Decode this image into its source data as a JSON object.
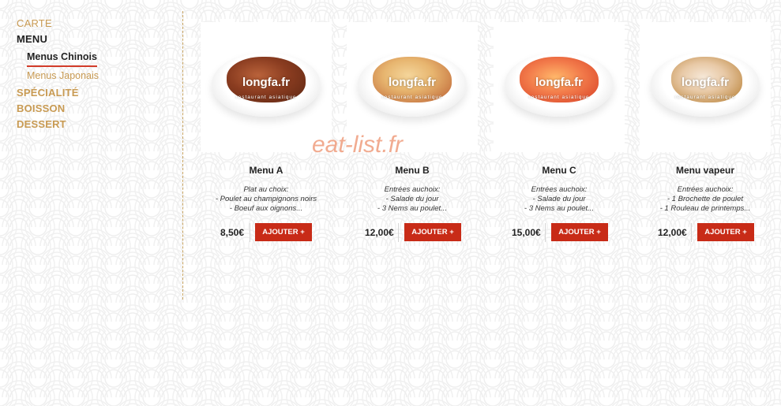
{
  "nav": {
    "carte": "CARTE",
    "menu": "MENU",
    "sub": {
      "chinois": "Menus Chinois",
      "japonais": "Menus Japonais"
    },
    "specialite": "SPÉCIALITÉ",
    "boisson": "BOISSON",
    "dessert": "DESSERT"
  },
  "watermark": "eat-list.fr",
  "image_watermark": {
    "brand": "longfa.fr",
    "tagline": "restaurant asiatique"
  },
  "products": [
    {
      "name": "Menu A",
      "desc": [
        "Plat au choix:",
        "- Poulet au champignons noirs",
        "- Boeuf aux oignons..."
      ],
      "price": "8,50€",
      "button": "AJOUTER +"
    },
    {
      "name": "Menu B",
      "desc": [
        "Entrées auchoix:",
        "- Salade du jour",
        "- 3 Nems au poulet..."
      ],
      "price": "12,00€",
      "button": "AJOUTER +"
    },
    {
      "name": "Menu C",
      "desc": [
        "Entrées auchoix:",
        "- Salade du jour",
        "- 3 Nems au poulet..."
      ],
      "price": "15,00€",
      "button": "AJOUTER +"
    },
    {
      "name": "Menu vapeur",
      "desc": [
        "Entrées auchoix:",
        "- 1 Brochette de poulet",
        "- 1 Rouleau de printemps..."
      ],
      "price": "12,00€",
      "button": "AJOUTER +"
    }
  ],
  "colors": {
    "accent": "#c82b17",
    "nav_gold": "#c89a52",
    "watermark": "#f0a284"
  }
}
